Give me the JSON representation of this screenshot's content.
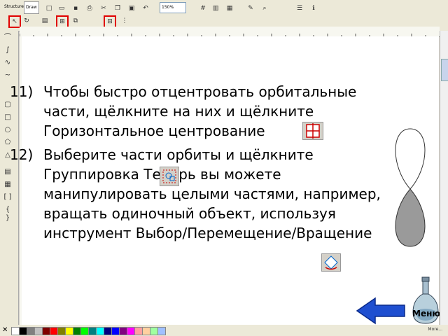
{
  "toolbar": {
    "tabs": [
      "Structure",
      "Draw"
    ],
    "zoom_value": "150%"
  },
  "slide": {
    "steps": [
      {
        "num": "11)",
        "lines": [
          "Чтобы быстро отцентровать орбитальные",
          "части, щёлкните на них и щёлкните",
          "Горизонтальное центрование"
        ]
      },
      {
        "num": "12)",
        "lines": [
          "Выберите части орбиты и щёлкните",
          "Группировка        Теперь вы можете",
          "манипулировать целыми частями, например,",
          "вращать одиночный объект, используя",
          "инструмент Выбор/Перемещение/Вращение"
        ]
      }
    ],
    "menu_label": "Меню"
  },
  "palette": {
    "colors": [
      "#ffffff",
      "#000000",
      "#808080",
      "#c0c0c0",
      "#800000",
      "#ff0000",
      "#808000",
      "#ffff00",
      "#008000",
      "#00ff00",
      "#008080",
      "#00ffff",
      "#000080",
      "#0000ff",
      "#800080",
      "#ff00ff",
      "#ffa0a0",
      "#ffd0a0",
      "#a0ffa0",
      "#a0c0ff"
    ],
    "more_label": "More..."
  },
  "colors": {
    "accent_red": "#e00000",
    "arrow_blue": "#1f4fd0",
    "bottle_gray": "#9a9a9a"
  }
}
